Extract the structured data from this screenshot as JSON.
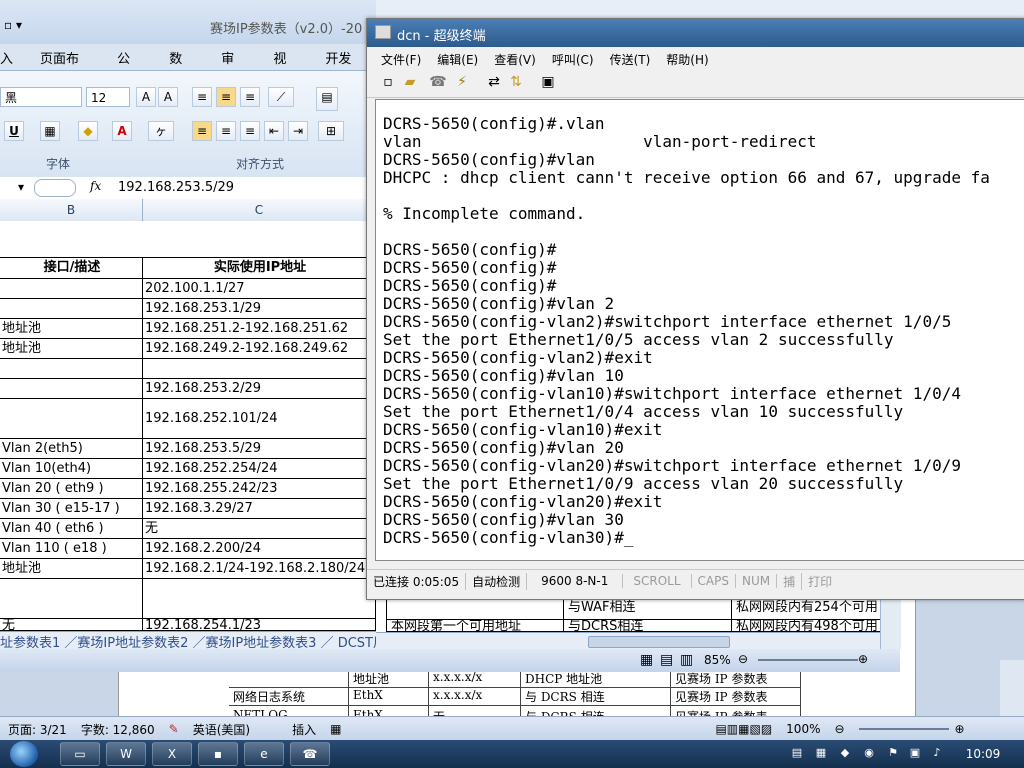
{
  "excel": {
    "title": "赛场IP参数表（v2.0）-20",
    "tabs": [
      "入",
      "页面布局",
      "公式",
      "数据",
      "审阅",
      "视图",
      "开发工"
    ],
    "font_name": "黑",
    "font_size": "12",
    "group_font": "字体",
    "group_align": "对齐方式",
    "formula_value": "192.168.253.5/29",
    "fx": "fx",
    "col_b": "B",
    "col_c": "C",
    "header_b": "接口/描述",
    "header_c": "实际使用IP地址",
    "rows": [
      {
        "b": "",
        "c": "202.100.1.1/27"
      },
      {
        "b": "",
        "c": "192.168.253.1/29"
      },
      {
        "b": "地址池",
        "c": "192.168.251.2-192.168.251.62"
      },
      {
        "b": "地址池",
        "c": "192.168.249.2-192.168.249.62"
      },
      {
        "b": "",
        "c": ""
      },
      {
        "b": "",
        "c": "192.168.253.2/29"
      },
      {
        "b": "",
        "c": "192.168.252.101/24"
      },
      {
        "b": "Vlan 2(eth5)",
        "c": "192.168.253.5/29"
      },
      {
        "b": "Vlan 10(eth4)",
        "c": "192.168.252.254/24"
      },
      {
        "b": "Vlan 20 ( eth9 )",
        "c": "192.168.255.242/23"
      },
      {
        "b": "Vlan 30 ( e15-17 )",
        "c": "192.168.3.29/27"
      },
      {
        "b": "Vlan 40 ( eth6 )",
        "c": "无"
      },
      {
        "b": "Vlan 110 ( e18 )",
        "c": "192.168.2.200/24"
      },
      {
        "b": "地址池",
        "c": "192.168.2.1/24-192.168.2.180/24"
      }
    ],
    "bottom_row": {
      "b": "无",
      "c": "192.168.254.1/23"
    },
    "right_rows": [
      {
        "d": "",
        "e": "与WAF相连",
        "f": "私网网段内有254个可用"
      },
      {
        "d": "本网段第一个可用地址",
        "e": "与DCRS相连",
        "f": "私网网段内有498个可用"
      }
    ],
    "sheet_tabs": "址参数表1 ／赛场IP地址参数表2 ／赛场IP地址参数表3 ／ DCST用户登录表 ／赛场互联接口",
    "zoom": "85%"
  },
  "word": {
    "rows": [
      {
        "a": "",
        "b": "地址池",
        "c": "x.x.x.x/x",
        "d": "DHCP 地址池",
        "e": "见赛场 IP 参数表"
      },
      {
        "a": "网络日志系统",
        "b": "EthX",
        "c": "x.x.x.x/x",
        "d": "与 DCRS 相连",
        "e": "见赛场 IP 参数表"
      },
      {
        "a": "NETLOG",
        "b": "EthX",
        "c": "无",
        "d": "与 DCRS 相连",
        "e": "见赛场 IP 参数表"
      }
    ],
    "status": {
      "page": "页面: 3/21",
      "words": "字数: 12,860",
      "language": "英语(美国)",
      "insert": "插入",
      "zoom": "100%"
    }
  },
  "dcn": {
    "title": "dcn - 超级终端",
    "menu": [
      "文件(F)",
      "编辑(E)",
      "查看(V)",
      "呼叫(C)",
      "传送(T)",
      "帮助(H)"
    ],
    "terminal_lines": [
      "DCRS-5650(config)#.vlan",
      "vlan                       vlan-port-redirect",
      "DCRS-5650(config)#vlan",
      "DHCPC : dhcp client cann't receive option 66 and 67, upgrade fa",
      "",
      "% Incomplete command.",
      "",
      "DCRS-5650(config)#",
      "DCRS-5650(config)#",
      "DCRS-5650(config)#",
      "DCRS-5650(config)#vlan 2",
      "DCRS-5650(config-vlan2)#switchport interface ethernet 1/0/5",
      "Set the port Ethernet1/0/5 access vlan 2 successfully",
      "DCRS-5650(config-vlan2)#exit",
      "DCRS-5650(config)#vlan 10",
      "DCRS-5650(config-vlan10)#switchport interface ethernet 1/0/4",
      "Set the port Ethernet1/0/4 access vlan 10 successfully",
      "DCRS-5650(config-vlan10)#exit",
      "DCRS-5650(config)#vlan 20",
      "DCRS-5650(config-vlan20)#switchport interface ethernet 1/0/9",
      "Set the port Ethernet1/0/9 access vlan 20 successfully",
      "DCRS-5650(config-vlan20)#exit",
      "DCRS-5650(config)#vlan 30",
      "DCRS-5650(config-vlan30)#_"
    ],
    "status": {
      "connected": "已连接 0:05:05",
      "detect": "自动检测",
      "params": "9600 8-N-1",
      "scroll": "SCROLL",
      "caps": "CAPS",
      "num": "NUM",
      "capture": "捕",
      "print": "打印"
    }
  },
  "taskbar": {
    "clock": "10:09"
  }
}
